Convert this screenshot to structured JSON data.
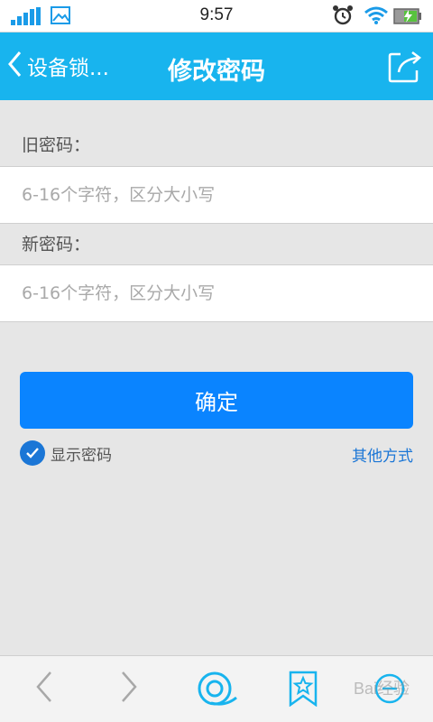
{
  "status_bar": {
    "time": "9:57"
  },
  "title_bar": {
    "back_label": "设备锁...",
    "title": "修改密码"
  },
  "form": {
    "old_password": {
      "label": "旧密码：",
      "placeholder": "6-16个字符，区分大小写",
      "value": ""
    },
    "new_password": {
      "label": "新密码：",
      "placeholder": "6-16个字符，区分大小写",
      "value": ""
    }
  },
  "confirm_label": "确定",
  "show_password": {
    "label": "显示密码",
    "checked": true
  },
  "other_ways_label": "其他方式",
  "watermark": "Bai经验",
  "colors": {
    "header": "#18b4ee",
    "primary_button": "#0a84ff",
    "link": "#1b76d6",
    "background": "#e6e6e6"
  }
}
